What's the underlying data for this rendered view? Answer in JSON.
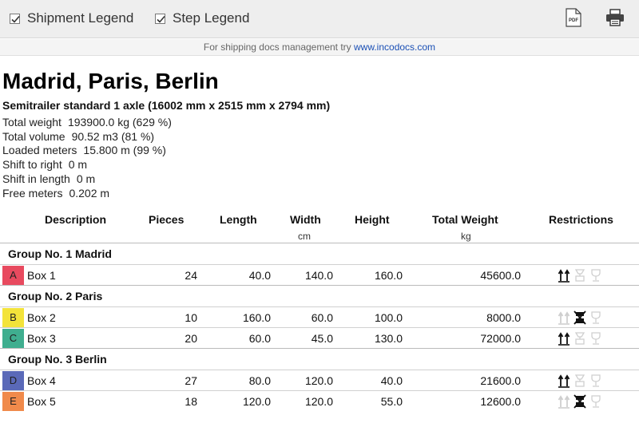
{
  "toolbar": {
    "shipment_legend_label": "Shipment Legend",
    "step_legend_label": "Step Legend",
    "pdf_icon": "pdf-icon",
    "print_icon": "printer-icon"
  },
  "banner": {
    "text": "For shipping docs management try ",
    "link_text": "www.incodocs.com"
  },
  "header": {
    "title": "Madrid, Paris, Berlin",
    "subtitle": "Semitrailer standard 1 axle (16002 mm x 2515 mm x 2794 mm)",
    "stats": [
      {
        "label": "Total weight",
        "value": "193900.0 kg (629 %)"
      },
      {
        "label": "Total volume",
        "value": "90.52 m3 (81 %)"
      },
      {
        "label": "Loaded meters",
        "value": "15.800 m (99 %)"
      },
      {
        "label": "Shift to right",
        "value": "0 m"
      },
      {
        "label": "Shift in length",
        "value": "0 m"
      },
      {
        "label": "Free meters",
        "value": "0.202 m"
      }
    ]
  },
  "table": {
    "columns": {
      "description": "Description",
      "pieces": "Pieces",
      "length": "Length",
      "width": "Width",
      "height": "Height",
      "total_weight": "Total Weight",
      "restrictions": "Restrictions",
      "unit_cm": "cm",
      "unit_kg": "kg"
    },
    "groups": [
      {
        "label": "Group No. 1 Madrid",
        "rows": [
          {
            "tag": "A",
            "color": "#e84a5f",
            "name": "Box 1",
            "pieces": "24",
            "length": "40.0",
            "width": "140.0",
            "height": "160.0",
            "weight": "45600.0",
            "restrictions": [
              "up-arrows-active",
              "stack-inactive",
              "fragile-inactive"
            ]
          }
        ]
      },
      {
        "label": "Group No. 2 Paris",
        "rows": [
          {
            "tag": "B",
            "color": "#f3e33a",
            "name": "Box 2",
            "pieces": "10",
            "length": "160.0",
            "width": "60.0",
            "height": "100.0",
            "weight": "8000.0",
            "restrictions": [
              "up-arrows-inactive",
              "no-stack-active",
              "fragile-inactive"
            ]
          },
          {
            "tag": "C",
            "color": "#3fae8f",
            "name": "Box 3",
            "pieces": "20",
            "length": "60.0",
            "width": "45.0",
            "height": "130.0",
            "weight": "72000.0",
            "restrictions": [
              "up-arrows-active",
              "stack-inactive",
              "fragile-inactive"
            ]
          }
        ]
      },
      {
        "label": "Group No. 3 Berlin",
        "rows": [
          {
            "tag": "D",
            "color": "#5a69b8",
            "name": "Box 4",
            "pieces": "27",
            "length": "80.0",
            "width": "120.0",
            "height": "40.0",
            "weight": "21600.0",
            "restrictions": [
              "up-arrows-active",
              "stack-inactive",
              "fragile-inactive"
            ]
          },
          {
            "tag": "E",
            "color": "#f08a4b",
            "name": "Box 5",
            "pieces": "18",
            "length": "120.0",
            "width": "120.0",
            "height": "55.0",
            "weight": "12600.0",
            "restrictions": [
              "up-arrows-inactive",
              "no-stack-active",
              "fragile-inactive"
            ]
          }
        ]
      }
    ]
  }
}
